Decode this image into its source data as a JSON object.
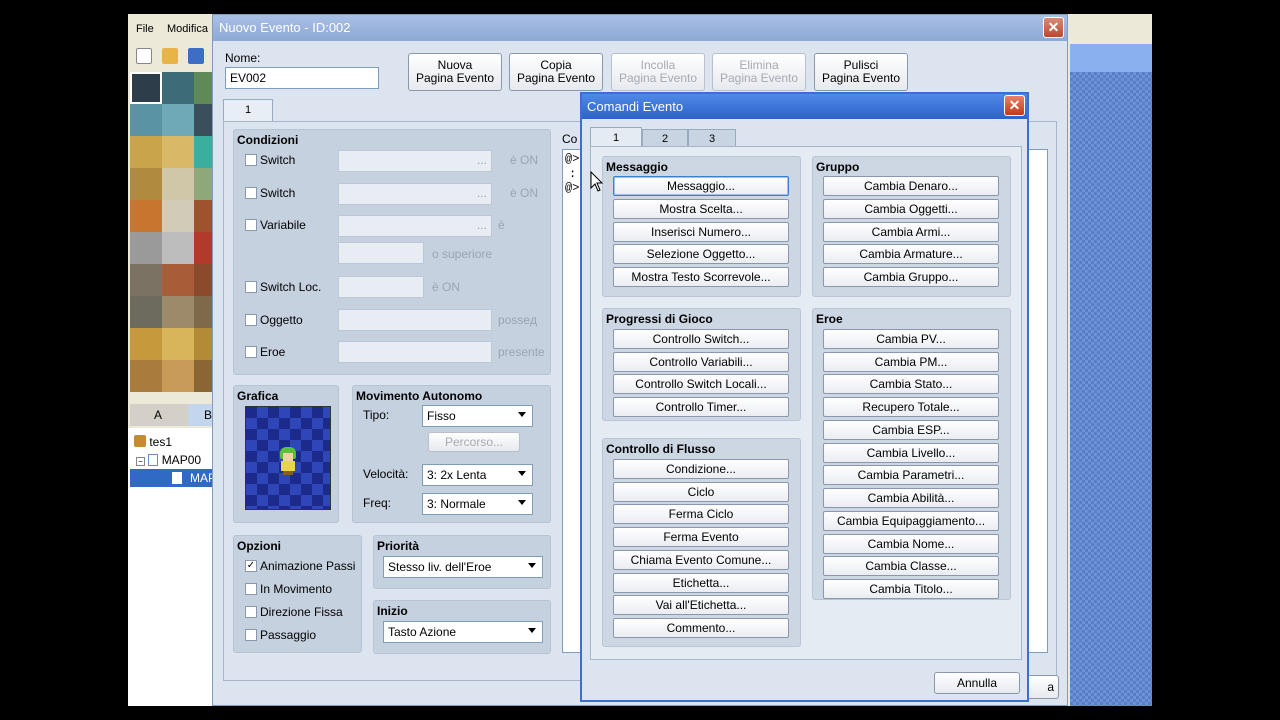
{
  "bg": {
    "menu": [
      "File",
      "Modifica"
    ],
    "tab_a": "A",
    "tab_b": "B",
    "tree": [
      "tes1",
      "MAP00",
      "MAP"
    ]
  },
  "event": {
    "title": "Nuovo Evento - ID:002",
    "name_label": "Nome:",
    "name_value": "EV002",
    "buttons": {
      "new_page": [
        "Nuova",
        "Pagina Evento"
      ],
      "copy_page": [
        "Copia",
        "Pagina Evento"
      ],
      "paste_page": [
        "Incolla",
        "Pagina Evento"
      ],
      "delete_page": [
        "Elimina",
        "Pagina Evento"
      ],
      "clear_page": [
        "Pulisci",
        "Pagina Evento"
      ]
    },
    "page_tab": "1",
    "conditions": {
      "title": "Condizioni",
      "switch1": "Switch",
      "switch2": "Switch",
      "variable": "Variabile",
      "local_switch": "Switch Loc.",
      "item": "Oggetto",
      "hero": "Eroe",
      "is_on": "è ON",
      "is": "è",
      "or_above": "o superiore",
      "possessed": "posseд",
      "present": "presente",
      "ellipsis": "..."
    },
    "graphic_title": "Grafica",
    "movement": {
      "title": "Movimento Autonomo",
      "type_label": "Tipo:",
      "type_value": "Fisso",
      "route_btn": "Percorso...",
      "speed_label": "Velocità:",
      "speed_value": "3: 2x Lenta",
      "freq_label": "Freq:",
      "freq_value": "3: Normale"
    },
    "options": {
      "title": "Opzioni",
      "walk_anim": "Animazione Passi",
      "moving": "In Movimento",
      "fixed_dir": "Direzione Fissa",
      "passage": "Passaggio"
    },
    "priority": {
      "title": "Priorità",
      "value": "Stesso liv. dell'Eroe"
    },
    "trigger": {
      "title": "Inizio",
      "value": "Tasto Azione"
    },
    "commands_label": "Co",
    "command_lines": [
      "@>",
      ":",
      "@>"
    ],
    "hidden_btn": "a"
  },
  "commands": {
    "title": "Comandi Evento",
    "tabs": [
      "1",
      "2",
      "3"
    ],
    "messaggio": {
      "title": "Messaggio",
      "items": [
        "Messaggio...",
        "Mostra Scelta...",
        "Inserisci Numero...",
        "Selezione Oggetto...",
        "Mostra Testo Scorrevole..."
      ]
    },
    "gruppo": {
      "title": "Gruppo",
      "items": [
        "Cambia Denaro...",
        "Cambia Oggetti...",
        "Cambia Armi...",
        "Cambia Armature...",
        "Cambia Gruppo..."
      ]
    },
    "progressi": {
      "title": "Progressi di Gioco",
      "items": [
        "Controllo Switch...",
        "Controllo Variabili...",
        "Controllo Switch Locali...",
        "Controllo Timer..."
      ]
    },
    "eroe": {
      "title": "Eroe",
      "items": [
        "Cambia PV...",
        "Cambia PM...",
        "Cambia Stato...",
        "Recupero Totale...",
        "Cambia ESP...",
        "Cambia Livello...",
        "Cambia Parametri...",
        "Cambia Abilità...",
        "Cambia Equipaggiamento...",
        "Cambia Nome...",
        "Cambia Classe...",
        "Cambia Titolo..."
      ]
    },
    "flusso": {
      "title": "Controllo di Flusso",
      "items": [
        "Condizione...",
        "Ciclo",
        "Ferma Ciclo",
        "Ferma Evento",
        "Chiama Evento Comune...",
        "Etichetta...",
        "Vai all'Etichetta...",
        "Commento..."
      ]
    },
    "cancel": "Annulla"
  },
  "colors": {
    "titlebar_active": "#2d62c8",
    "dialog_bg": "#dbe4ef",
    "close_red": "#c23a18"
  }
}
